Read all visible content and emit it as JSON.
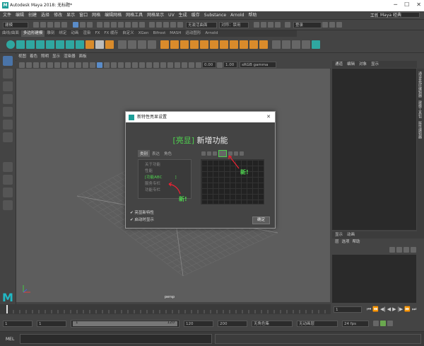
{
  "window": {
    "title": "Autodesk Maya 2018: 无标题*",
    "logo": "M"
  },
  "menubar": {
    "items": [
      "文件",
      "编辑",
      "创建",
      "选择",
      "修改",
      "显示",
      "窗口",
      "网格",
      "编辑网格",
      "网格工具",
      "网格显示",
      "UV",
      "生成",
      "缓存",
      "Substance",
      "Arnold",
      "帮助"
    ],
    "workspace_label": "工作区：",
    "workspace_value": "Maya 经典"
  },
  "statusline": {
    "mode": "建模",
    "no_live": "无激活曲面",
    "symmetry": "对称：禁用",
    "login": "登录"
  },
  "shelf": {
    "tabs": [
      "曲线/曲面",
      "多边形建模",
      "雕刻",
      "绑定",
      "动画",
      "渲染",
      "FX",
      "FX 缓存",
      "自定义",
      "XGen",
      "Bifrost",
      "MASH",
      "运动图形",
      "Arnold"
    ],
    "active_tab": "多边形建模"
  },
  "viewport": {
    "menu": [
      "视图",
      "着色",
      "照明",
      "显示",
      "渲染器",
      "面板"
    ],
    "field_a": "0.00",
    "field_b": "1.00",
    "colorspace": "sRGB gamma",
    "camera_label": "persp"
  },
  "channel_box": {
    "tabs": [
      "通道",
      "编辑",
      "对象",
      "显示"
    ],
    "side_tabs": [
      "通道盒/层编辑器",
      "建模工具包",
      "属性编辑器"
    ]
  },
  "layer_editor": {
    "tabs": [
      "显示",
      "动画"
    ],
    "menu": [
      "层",
      "选项",
      "帮助"
    ]
  },
  "dialog": {
    "title": "新特性亮显设置",
    "heading_bracketed": "[亮显]",
    "heading_text": "新增功能",
    "subtabs": [
      "类别",
      "表达",
      "角色"
    ],
    "list": [
      "关于功能",
      "性能",
      "功能ABC",
      "服务专栏",
      "功能专栏"
    ],
    "selected_index": 2,
    "new_label_1": "新!",
    "new_label_2": "新!",
    "checkbox_1": "亮显新特性",
    "checkbox_2": "启动时显示",
    "ok_label": "确定"
  },
  "timeline": {
    "frame_current": "1"
  },
  "range": {
    "start": "1",
    "start2": "1",
    "slider_start": "1",
    "slider_end": "120",
    "end": "120",
    "end2": "200",
    "char_set": "无角色集",
    "anim_layer": "无动画层",
    "fps": "24 fps"
  },
  "cmdline": {
    "label": "MEL"
  }
}
